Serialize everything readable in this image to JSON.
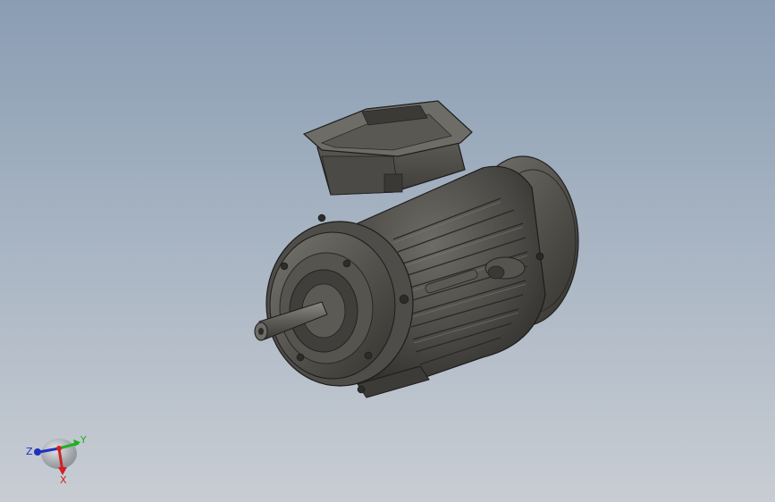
{
  "viewport": {
    "background_top": "#8a9db3",
    "background_bottom": "#c8cdd3"
  },
  "model": {
    "name_icon": "electric-motor-model",
    "body_color": "#4a4945",
    "highlight_color": "#7d7b74"
  },
  "triad": {
    "x_label": "X",
    "y_label": "Y",
    "z_label": "Z",
    "x_color": "#d02020",
    "y_color": "#20b020",
    "z_color": "#2030c0"
  }
}
